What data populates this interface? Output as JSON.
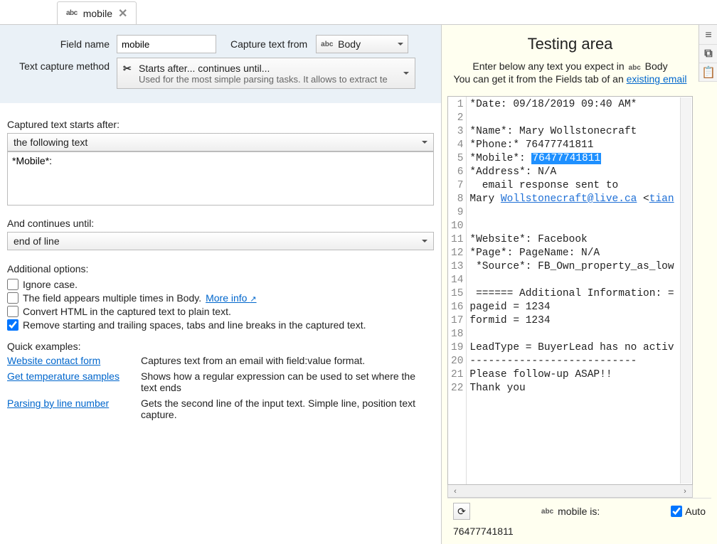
{
  "tab": {
    "icon_label": "abc",
    "title": "mobile"
  },
  "config": {
    "field_name_label": "Field name",
    "field_name_value": "mobile",
    "capture_from_label": "Capture text from",
    "capture_from_icon": "abc",
    "capture_from_value": "Body",
    "method_label": "Text capture method",
    "method_title": "Starts after... continues until...",
    "method_sub": "Used for the most simple parsing tasks. It allows to extract te"
  },
  "starts_after": {
    "label": "Captured text starts after:",
    "mode": "the following text",
    "text": "*Mobile*:"
  },
  "continues_until": {
    "label": "And continues until:",
    "mode": "end of line"
  },
  "options": {
    "label": "Additional options:",
    "ignore_case": {
      "checked": false,
      "label": "Ignore case."
    },
    "multiple": {
      "checked": false,
      "label": "The field appears multiple times in Body.",
      "more": "More info"
    },
    "convert_html": {
      "checked": false,
      "label": "Convert HTML in the captured text to plain text."
    },
    "trim": {
      "checked": true,
      "label": "Remove starting and trailing spaces, tabs and line breaks in the captured text."
    }
  },
  "examples": {
    "label": "Quick examples:",
    "rows": [
      {
        "link": "Website contact form",
        "desc": "Captures text from an email with field:value format."
      },
      {
        "link": "Get temperature samples",
        "desc": "Shows how a regular expression can be used to set where the text ends"
      },
      {
        "link": "Parsing by line number",
        "desc": "Gets the second line of the input text. Simple line, position text capture."
      }
    ]
  },
  "testing": {
    "title": "Testing area",
    "hint1_pre": "Enter below any text you expect in ",
    "hint1_icon": "abc",
    "hint1_post": " Body",
    "hint2_pre": "You can get it from the Fields tab of an ",
    "hint2_link": "existing email",
    "lines": [
      "*Date: 09/18/2019 09:40 AM*",
      "",
      "*Name*: Mary Wollstonecraft",
      "*Phone:* 76477741811",
      {
        "pre": "*Mobile*: ",
        "hl": "76477741811"
      },
      "*Address*: N/A",
      "  email response sent to",
      {
        "pre": "Mary ",
        "link1": "Wollstonecraft@live.ca",
        "mid": " <",
        "link2": "tian"
      },
      "",
      "",
      "*Website*: Facebook",
      "*Page*: PageName: N/A",
      " *Source*: FB_Own_property_as_low",
      "",
      " ====== Additional Information: =",
      "pageid = 1234",
      "formid = 1234",
      "",
      "LeadType = BuyerLead has no activ",
      "---------------------------",
      "Please follow-up ASAP!!",
      "Thank you"
    ],
    "result_label_icon": "abc",
    "result_label": "mobile is:",
    "auto_label": "Auto",
    "auto_checked": true,
    "result_value": "76477741811"
  }
}
